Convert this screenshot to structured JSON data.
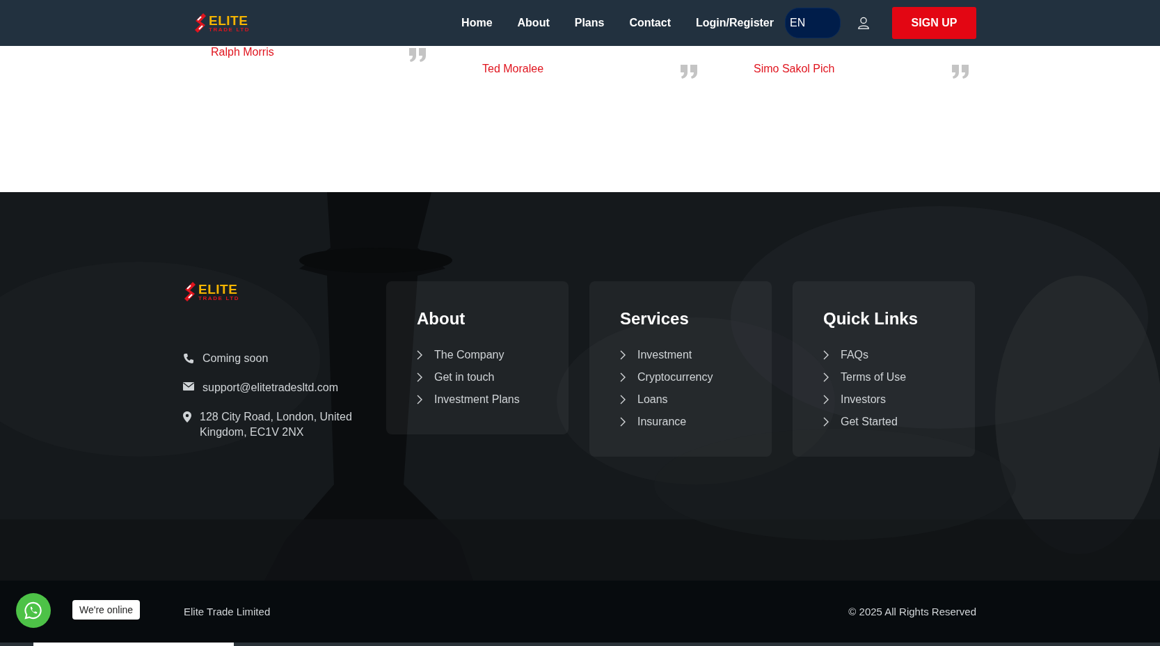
{
  "header": {
    "logo": {
      "word": "ELITE",
      "sub": "TRADE LTD"
    },
    "nav": [
      "Home",
      "About",
      "Plans",
      "Contact",
      "Login/Register"
    ],
    "language": "EN",
    "signup": "SIGN UP"
  },
  "testimonials": [
    {
      "name": "Ralph Morris"
    },
    {
      "name": "Ted Moralee"
    },
    {
      "name": "Simo Sakol Pich"
    }
  ],
  "footer": {
    "logo": {
      "word": "ELITE",
      "sub": "TRADE LTD"
    },
    "contacts": [
      {
        "kind": "phone",
        "text": "Coming soon"
      },
      {
        "kind": "email",
        "text": "support@elitetradesltd.com"
      },
      {
        "kind": "location",
        "text": "128 City Road, London, United Kingdom, EC1V 2NX"
      }
    ],
    "columns": [
      {
        "title": "About",
        "links": [
          "The Company",
          "Get in touch",
          "Investment Plans"
        ]
      },
      {
        "title": "Services",
        "links": [
          "Investment",
          "Cryptocurrency",
          "Loans",
          "Insurance"
        ]
      },
      {
        "title": "Quick Links",
        "links": [
          "FAQs",
          "Terms of Use",
          "Investors",
          "Get Started"
        ]
      }
    ]
  },
  "bottom_bar": {
    "company": "Elite Trade Limited",
    "copyright": "© 2025 All Rights Reserved"
  },
  "chat": {
    "status": "We're online"
  }
}
